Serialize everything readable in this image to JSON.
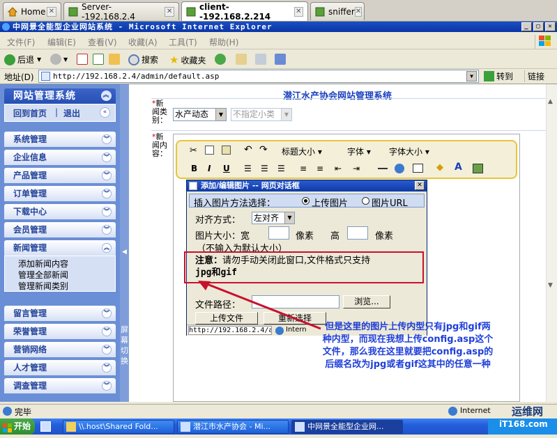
{
  "vm_tabs": [
    {
      "label": "Home",
      "icon": "home-icon"
    },
    {
      "label": "Server--192.168.2.4",
      "icon": "vm-icon"
    },
    {
      "label": "client--192.168.2.214",
      "icon": "vm-icon"
    },
    {
      "label": "sniffer",
      "icon": "vm-icon"
    }
  ],
  "window": {
    "title": "中网景全能型企业网站系统 - Microsoft Internet Explorer",
    "controls": [
      "_",
      "▢",
      "✕"
    ]
  },
  "menubar": {
    "items": [
      "文件(F)",
      "编辑(E)",
      "查看(V)",
      "收藏(A)",
      "工具(T)",
      "帮助(H)"
    ]
  },
  "toolbar": {
    "back": "后退",
    "search": "搜索",
    "favorites": "收藏夹"
  },
  "address": {
    "label": "地址(D)",
    "url": "http://192.168.2.4/admin/default.asp",
    "go": "转到",
    "links": "链接"
  },
  "sidebar": {
    "header": "网站管理系统",
    "home_link": "回到首页",
    "logout_link": "退出",
    "separator": "|",
    "items": [
      {
        "label": "系统管理"
      },
      {
        "label": "企业信息"
      },
      {
        "label": "产品管理"
      },
      {
        "label": "订单管理"
      },
      {
        "label": "下载中心"
      },
      {
        "label": "会员管理"
      },
      {
        "label": "新闻管理",
        "expanded": true
      }
    ],
    "news_sub": [
      "添加新闻内容",
      "管理全部新闻",
      "管理新闻类别"
    ],
    "items2": [
      {
        "label": "留言管理"
      },
      {
        "label": "荣誉管理"
      },
      {
        "label": "营销网络"
      },
      {
        "label": "人才管理"
      },
      {
        "label": "调查管理"
      }
    ],
    "splitter_label": "屏\n幕\n切\n换"
  },
  "main": {
    "title": "潜江水产协会网站管理系统",
    "category_label": "*新闻类别：",
    "category_label_lines": [
      "*新",
      "闻类",
      "别："
    ],
    "category_value": "水产动态",
    "subcategory_value": "不指定小类",
    "content_label_lines": [
      "*新",
      "闻内",
      "容："
    ],
    "editor": {
      "heading_size": "标题大小",
      "font": "字体",
      "font_size": "字体大小",
      "bold": "B",
      "italic": "I",
      "underline": "U"
    }
  },
  "dialog": {
    "title": "添加/编辑图片 -- 网页对话框",
    "method_label": "插入图片方法选择：",
    "option_upload": "上传图片",
    "option_url": "图片URL",
    "align_label": "对齐方式：",
    "align_value": "左对齐",
    "size_label": "图片大小：宽",
    "size_unit1": "像素",
    "size_height": "高",
    "size_unit2": "像素",
    "size_hint": "（不输入为默认大小）",
    "notice_bold": "注意：",
    "notice_text": "请勿手动关闭此窗口,文件格式只支持",
    "notice_formats": "jpg和gif",
    "path_label": "文件路径：",
    "browse": "浏览...",
    "upload_btn": "上传文件",
    "reselect_btn": "重新选择",
    "status_url": "http://192.168.2.4/a",
    "status_zone": "Intern"
  },
  "annotation": {
    "text": "但是这里的图片上传内型只有jpg和gif两种内型，而现在我想上传config.asp这个文件，那么我在这里就要把config.asp的后缀名改为jpg或者gif这其中的任意一种",
    "lines": [
      "但是这里的图片上传内型只有jpg和gif两",
      "种内型，而现在我想上传config.asp这个",
      "文件，那么我在这里就要把config.asp的",
      "后缀名改为jpg或者gif这其中的任意一种"
    ],
    "color": "#1f3fd8",
    "box_color": "#c8102e"
  },
  "statusbar": {
    "text": "完毕",
    "zone": "Internet"
  },
  "taskbar": {
    "start": "开始",
    "tasks": [
      "\\\\.host\\Shared Fold...",
      "潜江市水产协会 - Mi...",
      "中网景全能型企业网..."
    ]
  },
  "watermark": {
    "name": "运维网",
    "url": "iT168.com"
  }
}
